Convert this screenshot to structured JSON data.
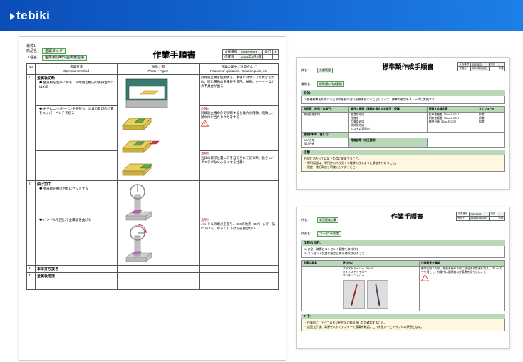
{
  "app": {
    "brand": "tebiki"
  },
  "main_doc": {
    "form_id": "様式1",
    "product_label": "商品名：",
    "product_name": "金属ラック",
    "process_label": "工程名：",
    "process_name": "金属板切断～金属板溶接",
    "title": "作業手順書",
    "top_right": {
      "r1c1": "文書番号",
      "r1c2": "SOPC0001",
      "r1c3": "改訂",
      "r1c4": "1",
      "r2c1": "作成日",
      "r2c2": "2024年3月2日",
      "r2c3": "",
      "r2c4": ""
    },
    "columns": {
      "no": "No.",
      "op": "作業方法\nOperation method",
      "fig": "画像／図\nPhoto／Figure",
      "rsn": "作業の理由／注意点など\nReason of operation／Caution point, etc"
    },
    "rows": [
      {
        "no": "1",
        "heading": "金属板切断",
        "bullets": [
          "金属板を左手に持ち、同端防止機内の保持治具にはめる"
        ],
        "reason": "同端防止機を使用する。素手に对サイズが異なるため、同じ種類の金属板を使用。破損、ショートなどの不具合が出る"
      },
      {
        "no": "",
        "heading": "",
        "bullets": [
          "右手にニッパーペンチを持ち、治具の目印の位置をニッパーペンチで切る"
        ],
        "reason_red": "危険!!",
        "reason": "同端防止機の外で切断すると破片が飛散。飛散し、顔や体に当たりケガをする"
      },
      {
        "no": "",
        "heading": "",
        "bullets": [],
        "reason_red": "急所!!",
        "reason": "治具の目印位置に刃を当てられて切る断。長さにバラつきがないようにする注意!!"
      },
      {
        "no": "2",
        "heading": "曲げ加工",
        "bullets": [
          "金属板を曲げ治具にセットする"
        ],
        "reason": ""
      },
      {
        "no": "",
        "heading": "",
        "bullets": [
          "ハンドルを回して金属板を曲げる"
        ],
        "reason_red": "急所!!",
        "reason": "ハンドルの端点を握り、360の地点（90°）まで一気に下げる。ゆっくり下げる必要はない"
      },
      {
        "no": "3",
        "heading": "本体打ち抜き",
        "bullets": [],
        "reason": ""
      },
      {
        "no": "4",
        "heading": "金属板溶接",
        "bullets": [],
        "reason": ""
      }
    ]
  },
  "topr_doc": {
    "title": "標準類作成手順書",
    "meta_left": {
      "l1": "件名：",
      "v1": "文書管理",
      "l2": "業務名：",
      "v2": "標準類の作成業務"
    },
    "meta_right": {
      "r1c1": "文書番号",
      "r1c2": "SOP0001",
      "r1c3": "改訂",
      "r1c4": "1",
      "r2c1": "作成日",
      "r2c2": "2024年3月2日",
      "r2c3": "",
      "r2c4": "作成"
    },
    "purpose_h": "目的：",
    "purpose": "1)各種標準を作成するときの業務の流れを標準化することによって、標準の制定をスムースに実施する。",
    "grid_headers": [
      "使用等（使用する部門）",
      "責任と権限（業務を担当する部門・役職）",
      "関連する規定等",
      "スケジュール"
    ],
    "grid_rows": [
      [
        "本社管理部門",
        "経営管理内\n生産者\n品質管理内\n技術管理内\nシステム管理内",
        "起草依頼書（Doc-F-001）\n制定依頼書（Doc-F-002）\n標準台帳（Doc-F-003）",
        "都度\n都度\n都度"
      ]
    ],
    "materials_h": "使用材料等（書入れ）",
    "materials": "SOP台帳\n改訂台帳",
    "equip_h": "用機器等（校正要求）",
    "equip": "",
    "note_h": "注意",
    "note": "作成にあたっては以下の点に留意すること。\n・専門用語は、専門外の人が見ても理解できるように解説を付けること。\n・制定・改訂事由を明確にしておくこと。"
  },
  "botr_doc": {
    "title": "作業手順書",
    "meta_left": {
      "l1": "件名：",
      "v1": "電気配線工事",
      "l2": "作業名：",
      "v2": "コンセント設置"
    },
    "meta_right": {
      "r1c1": "文書番号",
      "r1c2": "SOP0001",
      "r1c3": "改訂",
      "r1c4": "1",
      "r2c1": "作成日",
      "r2c2": "2024年3月29日",
      "r2c3": "",
      "r2c4": "作成"
    },
    "process_h": "工程の目的：",
    "process": "1) 安全・確実にコンセント配線を取付ける\n2) コンセント設置の施工品質を確保させること",
    "grid_headers": [
      "必要な器具",
      "使うもの",
      "作業時安全確認"
    ],
    "grid_row": [
      "",
      "プラスドライバー（No.2）\nマイナスドライバー\nペンチ／ニッパー",
      "感電を防ぐため、作業を始める前に該当する電源を切る。ブレーカーを落とし、作業中は関係者以外電源を切らないこと"
    ],
    "note_h": "メモ：",
    "note": "・作業前に、すべてのネジを完全に締め直したか確認すること。\n・設置完了後、電源を入れてテスターで通電を確認。これを抜かすとトラブルの原因となる。"
  }
}
